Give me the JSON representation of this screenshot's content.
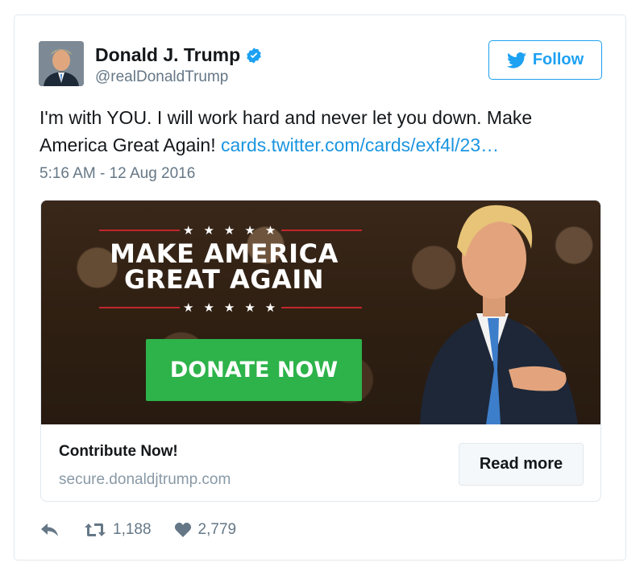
{
  "tweet": {
    "author": {
      "name": "Donald J. Trump",
      "handle": "@realDonaldTrump",
      "verified": true,
      "avatar_icon": "profile-photo"
    },
    "follow_label": "Follow",
    "text": "I'm with YOU. I will work hard and never let you down. Make America Great Again! ",
    "link": "cards.twitter.com/cards/exf4l/23…",
    "timestamp": "5:16 AM - 12 Aug 2016",
    "card": {
      "banner_stars_top": "★★★★★",
      "banner_line1": "MAKE AMERICA",
      "banner_line2": "GREAT AGAIN",
      "banner_stars_bottom": "★★★★★",
      "donate_label": "DONATE NOW",
      "title": "Contribute Now!",
      "url": "secure.donaldjtrump.com",
      "read_more_label": "Read more"
    },
    "actions": {
      "retweets": "1,188",
      "likes": "2,779"
    }
  },
  "colors": {
    "accent": "#1da1f2",
    "link": "#1b95e0",
    "muted": "#657786",
    "donate_green": "#2db34a"
  }
}
